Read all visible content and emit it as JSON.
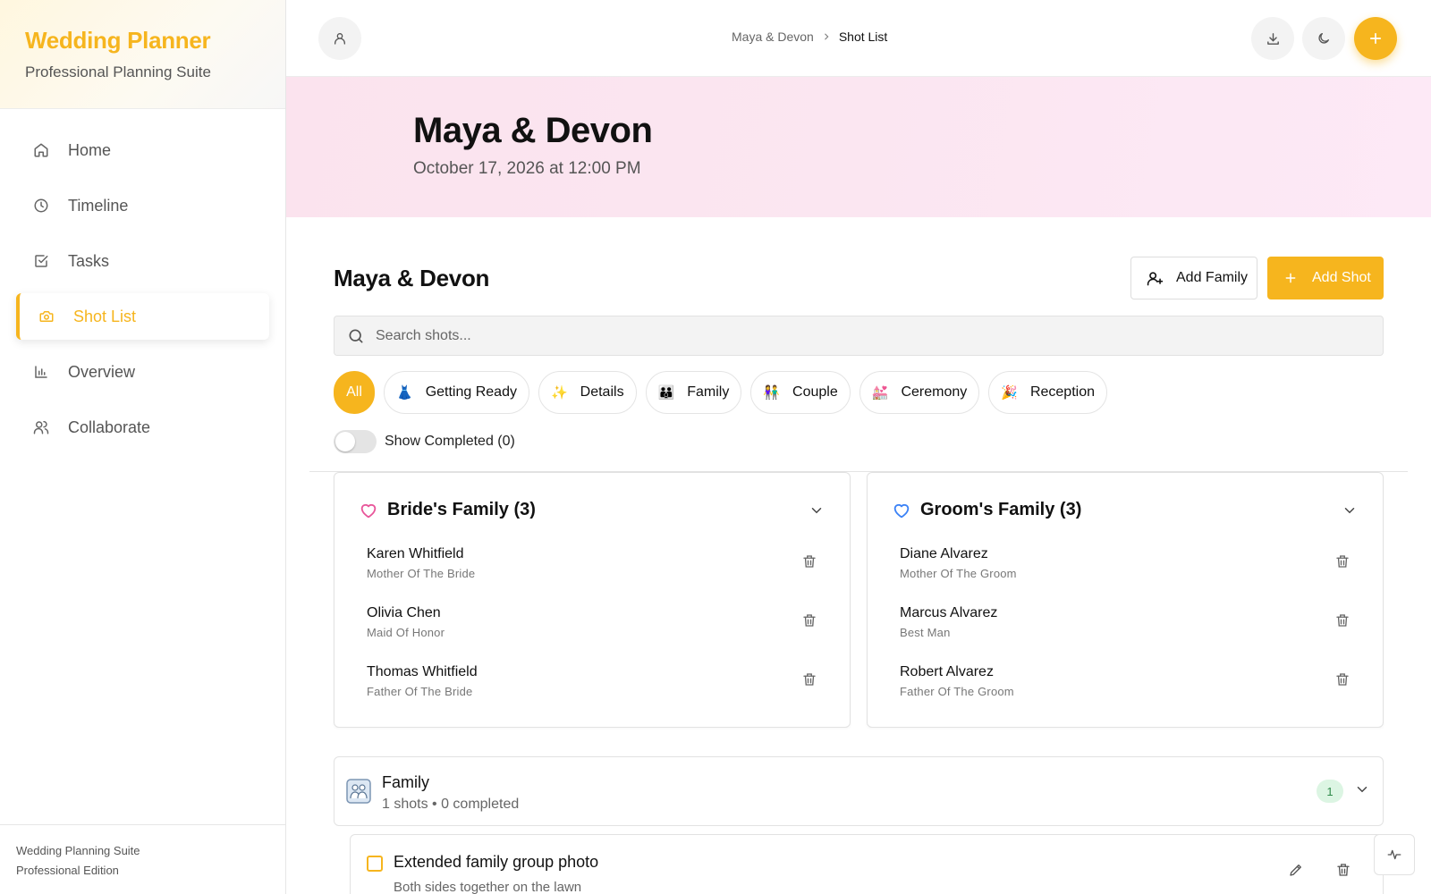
{
  "sidebar": {
    "brand_title": "Wedding Planner",
    "brand_subtitle": "Professional Planning Suite",
    "items": [
      {
        "label": "Home",
        "icon": "home-icon",
        "active": false
      },
      {
        "label": "Timeline",
        "icon": "clock-icon",
        "active": false
      },
      {
        "label": "Tasks",
        "icon": "checkbox-icon",
        "active": false
      },
      {
        "label": "Shot List",
        "icon": "camera-icon",
        "active": true
      },
      {
        "label": "Overview",
        "icon": "bar-chart-icon",
        "active": false
      },
      {
        "label": "Collaborate",
        "icon": "users-icon",
        "active": false
      }
    ],
    "footer_line1": "Wedding Planning Suite",
    "footer_line2": "Professional Edition"
  },
  "topbar": {
    "breadcrumb": {
      "parent": "Maya & Devon",
      "current": "Shot List"
    },
    "icons": [
      "user-icon",
      "download-icon",
      "moon-icon",
      "plus-icon"
    ]
  },
  "hero": {
    "title": "Maya & Devon",
    "date": "October 17, 2026 at 12:00 PM"
  },
  "main": {
    "title": "Maya & Devon",
    "add_family_label": "Add Family",
    "add_shot_label": "Add Shot",
    "search_placeholder": "Search shots...",
    "filters": [
      {
        "label": "All",
        "emoji": ""
      },
      {
        "label": "Getting Ready",
        "emoji": "👗"
      },
      {
        "label": "Details",
        "emoji": "✨"
      },
      {
        "label": "Family",
        "emoji": "👪"
      },
      {
        "label": "Couple",
        "emoji": "👫"
      },
      {
        "label": "Ceremony",
        "emoji": "💒"
      },
      {
        "label": "Reception",
        "emoji": "🎉"
      }
    ],
    "show_completed_label": "Show Completed (0)",
    "brides_family": {
      "title": "Bride's Family (3)",
      "members": [
        {
          "name": "Karen Whitfield",
          "role": "Mother Of The Bride"
        },
        {
          "name": "Olivia Chen",
          "role": "Maid Of Honor"
        },
        {
          "name": "Thomas Whitfield",
          "role": "Father Of The Bride"
        }
      ]
    },
    "grooms_family": {
      "title": "Groom's Family (3)",
      "members": [
        {
          "name": "Diane Alvarez",
          "role": "Mother Of The Groom"
        },
        {
          "name": "Marcus Alvarez",
          "role": "Best Man"
        },
        {
          "name": "Robert Alvarez",
          "role": "Father Of The Groom"
        }
      ]
    },
    "category": {
      "title": "Family",
      "subtitle": "1 shots • 0 completed",
      "badge": "1"
    },
    "shot": {
      "title": "Extended family group photo",
      "description": "Both sides together on the lawn"
    }
  },
  "colors": {
    "accent": "#f6b51e",
    "bride_heart": "#e8569a",
    "groom_heart": "#3b82f6",
    "hero_bg": "#fbe6f1"
  }
}
